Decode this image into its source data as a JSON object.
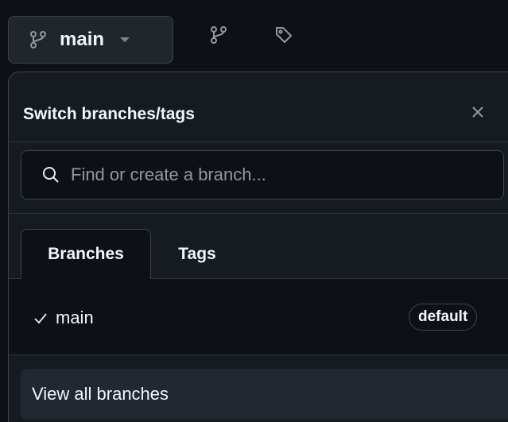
{
  "header": {
    "current_branch": "main",
    "icons": [
      "git-branch-icon",
      "chevron-down-icon",
      "git-branch-icon",
      "tag-icon"
    ]
  },
  "dropdown": {
    "title": "Switch branches/tags",
    "search": {
      "value": "",
      "placeholder": "Find or create a branch..."
    },
    "tabs": [
      {
        "label": "Branches",
        "selected": true
      },
      {
        "label": "Tags",
        "selected": false
      }
    ],
    "branches": [
      {
        "name": "main",
        "checked": true,
        "badge": "default"
      }
    ],
    "view_all_label": "View all branches"
  },
  "colors": {
    "background": "#0d1117",
    "panel": "#161b22",
    "border": "#3d444d",
    "text": "#f0f6fc",
    "muted": "#9198a1"
  }
}
